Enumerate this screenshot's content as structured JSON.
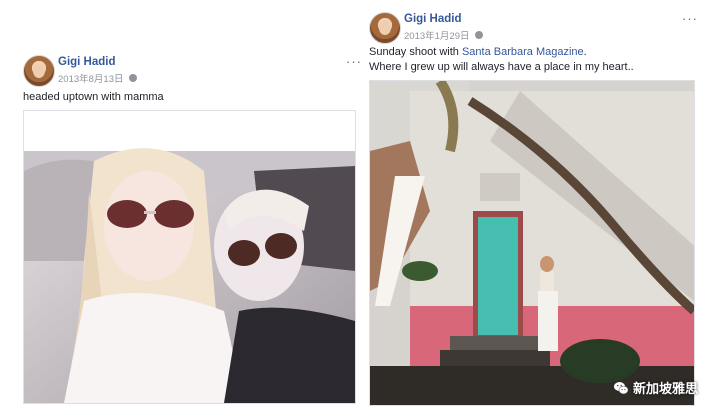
{
  "left_post": {
    "author": "Gigi Hadid",
    "date": "2013年8月13日",
    "more_icon": "ellipsis-icon",
    "text": "headed uptown with mamma"
  },
  "right_post": {
    "author": "Gigi Hadid",
    "date": "2013年1月29日",
    "more_icon": "ellipsis-icon",
    "text_prefix": "Sunday shoot with ",
    "text_link": "Santa Barbara Magazine",
    "text_suffix": ".",
    "text_line2": "Where I grew up will always have a place in my heart.."
  },
  "watermark": {
    "icon": "wechat-icon",
    "label": "新加坡雅思"
  }
}
